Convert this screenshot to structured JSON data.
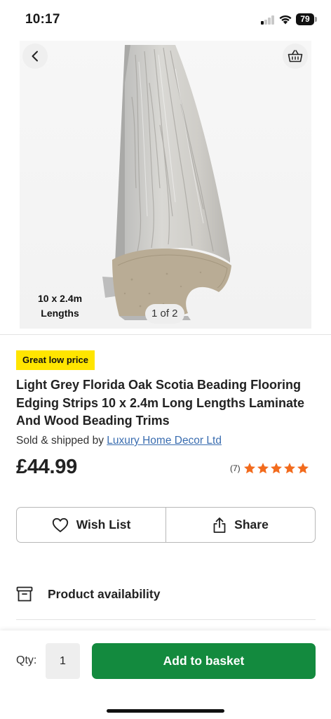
{
  "status_bar": {
    "time": "10:17",
    "battery": "79",
    "signal_bars_active": 1,
    "icons": [
      "signal-icon",
      "wifi-icon",
      "battery-icon"
    ]
  },
  "gallery": {
    "image_caption_line1": "10 x 2.4m",
    "image_caption_line2": "Lengths",
    "counter": "1 of 2",
    "icons": [
      "back-arrow-icon",
      "basket-icon"
    ]
  },
  "product": {
    "badge": "Great low price",
    "title": "Light Grey Florida Oak Scotia Beading Flooring Edging Strips 10 x 2.4m Long Lengths Laminate And Wood Beading Trims",
    "seller_prefix": "Sold & shipped by",
    "seller_name": "Luxury Home Decor Ltd",
    "price": "£44.99",
    "rating_count": "(7)",
    "rating_stars": 5
  },
  "actions": {
    "wishlist_label": "Wish List",
    "share_label": "Share",
    "icons": [
      "heart-icon",
      "share-icon"
    ]
  },
  "availability": {
    "label": "Product availability",
    "icon": "archive-box-icon"
  },
  "bottom_bar": {
    "qty_label": "Qty:",
    "qty_value": "1",
    "add_to_basket_label": "Add to basket"
  },
  "colors": {
    "badge": "#ffe500",
    "add_button": "#138a3e",
    "star": "#f26b1d",
    "seller_link": "#3a6db0"
  }
}
